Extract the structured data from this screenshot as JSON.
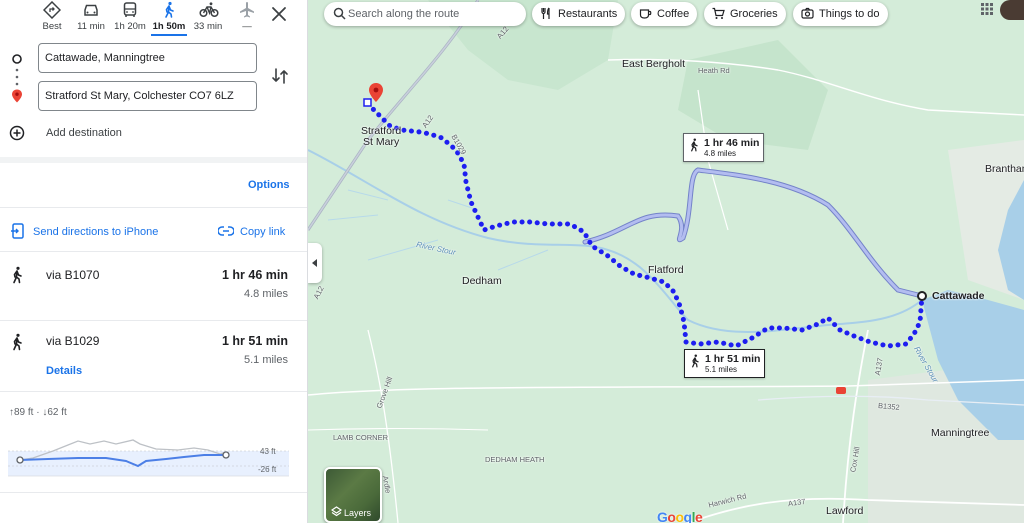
{
  "modes": [
    {
      "label": "Best",
      "icon": "directions-diamond-icon",
      "active": false
    },
    {
      "label": "11 min",
      "icon": "car-icon",
      "active": false
    },
    {
      "label": "1h 20m",
      "icon": "transit-icon",
      "active": false
    },
    {
      "label": "1h 50m",
      "icon": "walking-icon",
      "active": true
    },
    {
      "label": "33 min",
      "icon": "bicycle-icon",
      "active": false
    },
    {
      "label": "—",
      "icon": "flight-icon",
      "active": false
    }
  ],
  "origin": "Cattawade, Manningtree",
  "destination": "Stratford St Mary, Colchester CO7 6LZ",
  "add_destination": "Add destination",
  "options_label": "Options",
  "send_label": "Send directions to iPhone",
  "copy_label": "Copy link",
  "routes": [
    {
      "via": "via B1070",
      "time": "1 hr 46 min",
      "distance": "4.8 miles"
    },
    {
      "via": "via B1029",
      "time": "1 hr 51 min",
      "distance": "5.1 miles",
      "details": "Details"
    }
  ],
  "elevation": {
    "summary": "↑89 ft · ↓62 ft",
    "max_label": "43 ft",
    "min_label": "-26 ft"
  },
  "map": {
    "search_placeholder": "Search along the route",
    "chips": [
      "Restaurants",
      "Coffee",
      "Groceries",
      "Things to do"
    ],
    "callout_alt": {
      "time": "1 hr 46 min",
      "distance": "4.8 miles"
    },
    "callout_sel": {
      "time": "1 hr 51 min",
      "distance": "5.1 miles"
    },
    "places": {
      "east_bergholt": "East Bergholt",
      "heath_rd": "Heath Rd",
      "stratford": "Stratford\nSt Mary",
      "dedham": "Dedham",
      "flatford": "Flatford",
      "cattawade": "Cattawade",
      "manningtree": "Manningtree",
      "lawford": "Lawford",
      "brantham": "Branthan",
      "lamb_corner": "LAMB CORNER",
      "dedham_heath": "DEDHAM HEATH",
      "grove_hill": "Grove Hill",
      "river_stour": "River Stour",
      "river_stour2": "River Stour",
      "cox_hill": "Cox Hill",
      "harwich_rd": "Harwich Rd",
      "a12a": "A12",
      "a12b": "A12",
      "a12c": "A12",
      "a137": "A137",
      "a137b": "A137",
      "b1029": "B1029",
      "b1352": "B1352",
      "ardleigh": "Ardle"
    },
    "layers_label": "Layers",
    "google_logo": "Google"
  },
  "colors": {
    "accent": "#1a73e8",
    "route": "#1a1aff",
    "alt_route": "#a7b3e8",
    "map_bg": "#d4ecd9",
    "water": "#a8cfe8"
  }
}
